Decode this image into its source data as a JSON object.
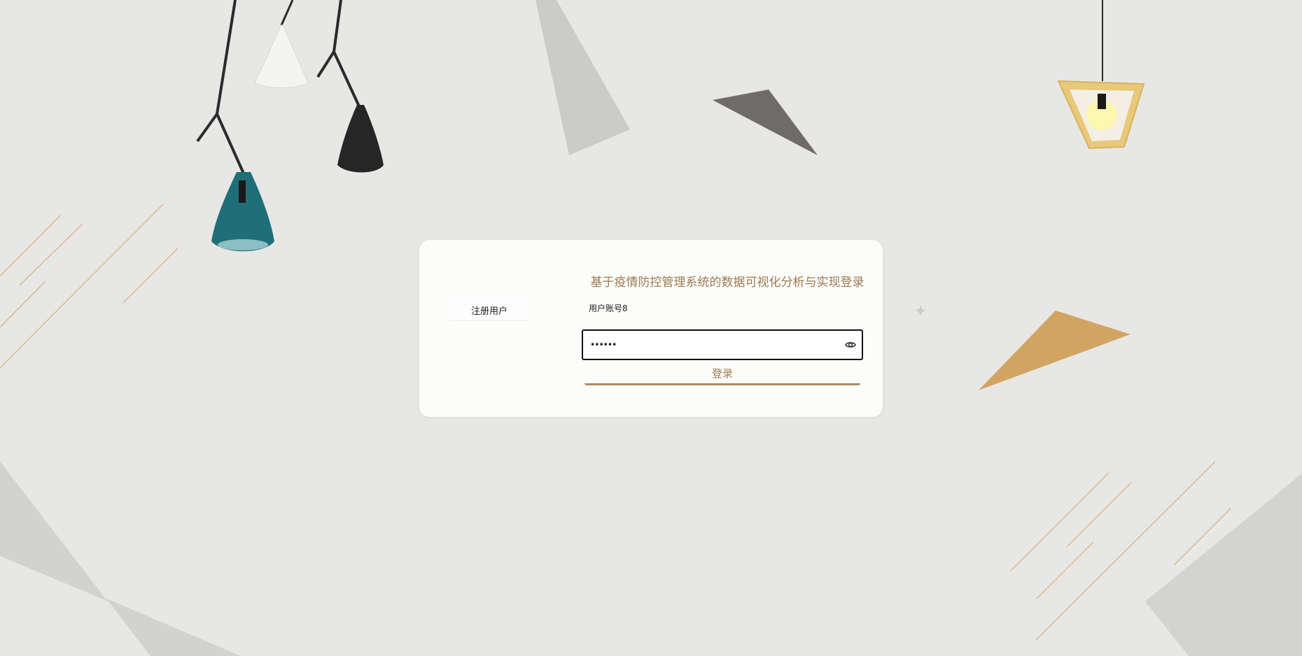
{
  "login": {
    "title": "基于疫情防控管理系统的数据可视化分析与实现登录",
    "register_label": "注册用户",
    "account_value": "用户账号8",
    "password_value": "••••••",
    "password_icon": "eye-icon",
    "login_label": "登录"
  },
  "colors": {
    "background": "#e7e7e5",
    "accent": "#a27d4f",
    "accent_line": "#d6a66c",
    "teal_lamp": "#1f6f78",
    "gold_triangle": "#d2a462"
  }
}
